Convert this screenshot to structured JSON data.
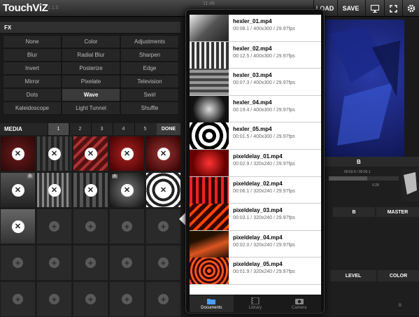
{
  "app": {
    "title": "TouchViZ",
    "version": "1.1.0",
    "clock": "11:46"
  },
  "toolbar": {
    "load": "LOAD",
    "save": "SAVE"
  },
  "fx": {
    "header": "FX",
    "items": [
      "None",
      "Color",
      "Adjustments",
      "Blur",
      "Radial Blur",
      "Sharpen",
      "Invert",
      "Posterize",
      "Edge",
      "Mirror",
      "Pixelate",
      "Television",
      "Dots",
      "Wave",
      "Swirl",
      "Kaleidoscope",
      "Light Tunnel",
      "Shuffle"
    ],
    "selected": "Wave"
  },
  "media": {
    "header": "MEDIA",
    "tabs": [
      "1",
      "2",
      "3",
      "4",
      "5"
    ],
    "active_tab": "1",
    "done": "DONE",
    "badges": {
      "b": "B",
      "a": "A"
    }
  },
  "right": {
    "b_label": "B",
    "master": "MASTER",
    "level": "LEVEL",
    "color": "COLOR",
    "timecode": "00:03.4 / 00:06.1",
    "value": "0.28",
    "b_small": "B"
  },
  "files": [
    {
      "name": "hexler_01.mp4",
      "meta": "00:08.1 / 400x300 / 29.97fps"
    },
    {
      "name": "hexler_02.mp4",
      "meta": "00:12.5 / 400x300 / 29.97fps"
    },
    {
      "name": "hexler_03.mp4",
      "meta": "00:07.3 / 400x300 / 29.97fps"
    },
    {
      "name": "hexler_04.mp4",
      "meta": "00:19.4 / 400x300 / 29.97fps"
    },
    {
      "name": "hexler_05.mp4",
      "meta": "00:01.5 / 400x300 / 29.97fps"
    },
    {
      "name": "pixeldelay_01.mp4",
      "meta": "00:02.9 / 320x240 / 29.97fps"
    },
    {
      "name": "pixeldelay_02.mp4",
      "meta": "00:06.1 / 320x240 / 29.97fps"
    },
    {
      "name": "pixeldelay_03.mp4",
      "meta": "00:03.1 / 320x240 / 29.97fps"
    },
    {
      "name": "pixeldelay_04.mp4",
      "meta": "00:02.0 / 320x240 / 29.97fps"
    },
    {
      "name": "pixeldelay_05.mp4",
      "meta": "00:01.9 / 320x240 / 29.97fps"
    }
  ],
  "tabbar": {
    "documents": "Documents",
    "library": "Library",
    "camera": "Camera"
  }
}
